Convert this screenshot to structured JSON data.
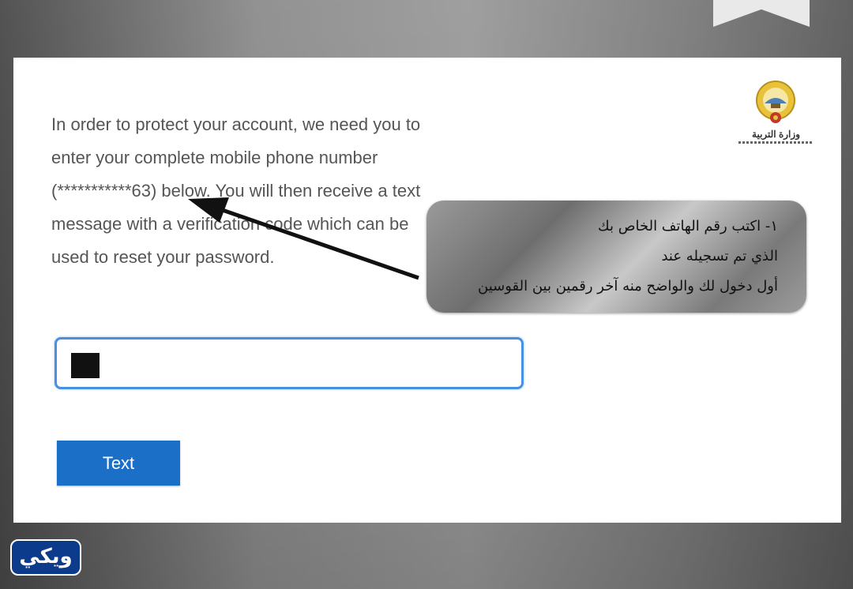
{
  "instructions": {
    "line1": "In order to protect your account, we need you to",
    "line2": "enter your complete mobile phone number",
    "line3": "(***********63) below. You will then receive a text",
    "line4": "message with a verification code which can be",
    "line5": "used to reset your password."
  },
  "logo": {
    "text": "وزارة التربية"
  },
  "phone_input": {
    "value": "",
    "placeholder": ""
  },
  "submit_button": {
    "label": "Text",
    "color": "#1c6fc7"
  },
  "overlay_note": {
    "line1": "١- اكتب رقم الهاتف الخاص بك",
    "line2": "الذي تم تسجيله عند",
    "line3": "أول دخول لك والواضح منه آخر رقمين بين القوسين"
  },
  "watermark": {
    "text": "ويكي"
  },
  "colors": {
    "input_border": "#4a90e2",
    "watermark_bg": "#0d3b8c"
  }
}
